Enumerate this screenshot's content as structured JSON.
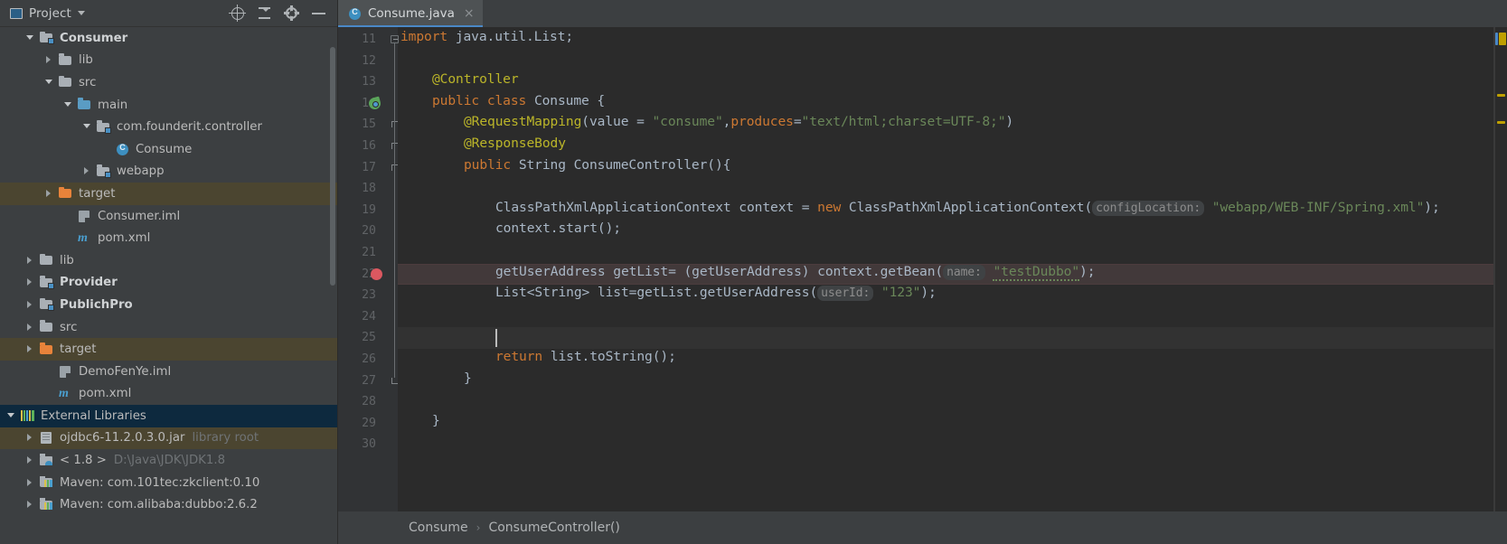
{
  "window": {
    "background": "#3c3f41",
    "editor_background": "#2b2b2b"
  },
  "sidebar": {
    "header": {
      "title": "Project",
      "icons": [
        "project-panel-icon",
        "chevron-down-icon"
      ],
      "actions": [
        {
          "name": "locate-file-icon",
          "tooltip": "Select Opened File"
        },
        {
          "name": "collapse-all-icon",
          "tooltip": "Collapse All"
        },
        {
          "name": "gear-icon",
          "tooltip": "Settings"
        },
        {
          "name": "hide-panel-icon",
          "tooltip": "Hide"
        }
      ]
    },
    "tree": [
      {
        "label": "Consumer",
        "indent": 0,
        "arrow": "open",
        "icon": "module-folder-icon",
        "bold": true,
        "selected": "none"
      },
      {
        "label": "lib",
        "indent": 1,
        "arrow": "closed",
        "icon": "folder-icon",
        "bold": false,
        "selected": "none"
      },
      {
        "label": "src",
        "indent": 1,
        "arrow": "open",
        "icon": "folder-icon",
        "bold": false,
        "selected": "none"
      },
      {
        "label": "main",
        "indent": 2,
        "arrow": "open",
        "icon": "source-folder-icon",
        "bold": false,
        "selected": "none"
      },
      {
        "label": "com.founderit.controller",
        "indent": 3,
        "arrow": "open",
        "icon": "package-icon",
        "bold": false,
        "selected": "none"
      },
      {
        "label": "Consume",
        "indent": 4,
        "arrow": "none",
        "icon": "java-class-icon",
        "bold": false,
        "selected": "none"
      },
      {
        "label": "webapp",
        "indent": 3,
        "arrow": "closed",
        "icon": "web-folder-icon",
        "bold": false,
        "selected": "none"
      },
      {
        "label": "target",
        "indent": 1,
        "arrow": "closed",
        "icon": "excluded-folder-icon",
        "bold": false,
        "selected": "olive"
      },
      {
        "label": "Consumer.iml",
        "indent": 2,
        "arrow": "none",
        "icon": "iml-file-icon",
        "bold": false,
        "selected": "none"
      },
      {
        "label": "pom.xml",
        "indent": 2,
        "arrow": "none",
        "icon": "maven-pom-icon",
        "bold": false,
        "selected": "none"
      },
      {
        "label": "lib",
        "indent": 0,
        "arrow": "closed",
        "icon": "folder-icon",
        "bold": false,
        "selected": "none"
      },
      {
        "label": "Provider",
        "indent": 0,
        "arrow": "closed",
        "icon": "module-folder-icon",
        "bold": true,
        "selected": "none"
      },
      {
        "label": "PublichPro",
        "indent": 0,
        "arrow": "closed",
        "icon": "module-folder-icon",
        "bold": true,
        "selected": "none"
      },
      {
        "label": "src",
        "indent": 0,
        "arrow": "closed",
        "icon": "folder-icon",
        "bold": false,
        "selected": "none"
      },
      {
        "label": "target",
        "indent": 0,
        "arrow": "closed",
        "icon": "excluded-folder-icon",
        "bold": false,
        "selected": "olive"
      },
      {
        "label": "DemoFenYe.iml",
        "indent": 1,
        "arrow": "none",
        "icon": "iml-file-icon",
        "bold": false,
        "selected": "none"
      },
      {
        "label": "pom.xml",
        "indent": 1,
        "arrow": "none",
        "icon": "maven-pom-icon",
        "bold": false,
        "selected": "none"
      },
      {
        "label": "External Libraries",
        "indent": -1,
        "arrow": "open",
        "icon": "external-libraries-icon",
        "bold": false,
        "selected": "blue"
      },
      {
        "label": "ojdbc6-11.2.0.3.0.jar",
        "indent": 0,
        "arrow": "closed",
        "icon": "jar-icon",
        "bold": false,
        "sub": "library root",
        "selected": "olive"
      },
      {
        "label": "< 1.8 >",
        "indent": 0,
        "arrow": "closed",
        "icon": "jdk-icon",
        "bold": false,
        "sub": "D:\\Java\\JDK\\JDK1.8",
        "selected": "none"
      },
      {
        "label": "Maven: com.101tec:zkclient:0.10",
        "indent": 0,
        "arrow": "closed",
        "icon": "maven-library-icon",
        "bold": false,
        "selected": "none"
      },
      {
        "label": "Maven: com.alibaba:dubbo:2.6.2",
        "indent": 0,
        "arrow": "closed",
        "icon": "maven-library-icon",
        "bold": false,
        "selected": "none"
      }
    ]
  },
  "editor": {
    "tab": {
      "label": "Consume.java",
      "icon": "java-class-icon",
      "close": "×",
      "active": true
    },
    "first_line_number": 11,
    "lines": [
      {
        "n": 11,
        "indent": 0,
        "tokens": [
          {
            "t": "import ",
            "c": "kw"
          },
          {
            "t": "java.util.List;",
            "c": "ident"
          }
        ]
      },
      {
        "n": 12,
        "indent": 0,
        "tokens": []
      },
      {
        "n": 13,
        "indent": 1,
        "tokens": [
          {
            "t": "@Controller",
            "c": "ann"
          }
        ]
      },
      {
        "n": 14,
        "indent": 1,
        "tokens": [
          {
            "t": "public ",
            "c": "kw"
          },
          {
            "t": "class ",
            "c": "kw"
          },
          {
            "t": "Consume {",
            "c": "ident"
          }
        ]
      },
      {
        "n": 15,
        "indent": 2,
        "tokens": [
          {
            "t": "@RequestMapping",
            "c": "ann"
          },
          {
            "t": "(value = ",
            "c": "ident"
          },
          {
            "t": "\"consume\"",
            "c": "str"
          },
          {
            "t": ",",
            "c": "ident"
          },
          {
            "t": "produces",
            "c": "kwb"
          },
          {
            "t": "=",
            "c": "ident"
          },
          {
            "t": "\"text/html;charset=UTF-8;\"",
            "c": "str"
          },
          {
            "t": ")",
            "c": "ident"
          }
        ]
      },
      {
        "n": 16,
        "indent": 2,
        "tokens": [
          {
            "t": "@ResponseBody",
            "c": "ann"
          }
        ]
      },
      {
        "n": 17,
        "indent": 2,
        "tokens": [
          {
            "t": "public ",
            "c": "kw"
          },
          {
            "t": "String ",
            "c": "ident"
          },
          {
            "t": "ConsumeController",
            "c": "method"
          },
          {
            "t": "(){",
            "c": "ident"
          }
        ]
      },
      {
        "n": 18,
        "indent": 0,
        "tokens": []
      },
      {
        "n": 19,
        "indent": 3,
        "tokens": [
          {
            "t": "ClassPathXmlApplicationContext context = ",
            "c": "ident"
          },
          {
            "t": "new ",
            "c": "kw"
          },
          {
            "t": "ClassPathXmlApplicationContext(",
            "c": "ident"
          },
          {
            "t": "configLocation:",
            "c": "hint"
          },
          {
            "t": " ",
            "c": "ident"
          },
          {
            "t": "\"webapp/WEB-INF/Spring.xml\"",
            "c": "str"
          },
          {
            "t": ");",
            "c": "ident"
          }
        ]
      },
      {
        "n": 20,
        "indent": 3,
        "tokens": [
          {
            "t": "context.start();",
            "c": "ident"
          }
        ]
      },
      {
        "n": 21,
        "indent": 0,
        "tokens": []
      },
      {
        "n": 22,
        "indent": 3,
        "highlight": "red",
        "breakpoint": true,
        "tokens": [
          {
            "t": "getUserAddress getList= (getUserAddress) context.getBean(",
            "c": "ident"
          },
          {
            "t": "name:",
            "c": "hint"
          },
          {
            "t": " ",
            "c": "ident"
          },
          {
            "t": "\"testDubbo\"",
            "c": "str-typo"
          },
          {
            "t": ");",
            "c": "ident"
          }
        ]
      },
      {
        "n": 23,
        "indent": 3,
        "tokens": [
          {
            "t": "List<String> list=getList.getUserAddress(",
            "c": "ident"
          },
          {
            "t": "userId:",
            "c": "hint"
          },
          {
            "t": " ",
            "c": "ident"
          },
          {
            "t": "\"123\"",
            "c": "str"
          },
          {
            "t": ");",
            "c": "ident"
          }
        ]
      },
      {
        "n": 24,
        "indent": 0,
        "tokens": []
      },
      {
        "n": 25,
        "indent": 0,
        "highlight": "caret",
        "tokens": []
      },
      {
        "n": 26,
        "indent": 3,
        "tokens": [
          {
            "t": "return ",
            "c": "kw"
          },
          {
            "t": "list.toString();",
            "c": "ident"
          }
        ]
      },
      {
        "n": 27,
        "indent": 2,
        "tokens": [
          {
            "t": "}",
            "c": "ident"
          }
        ]
      },
      {
        "n": 28,
        "indent": 0,
        "tokens": []
      },
      {
        "n": 29,
        "indent": 1,
        "tokens": [
          {
            "t": "}",
            "c": "ident"
          }
        ]
      },
      {
        "n": 30,
        "indent": 0,
        "tokens": []
      }
    ],
    "gutter_markers": [
      {
        "line": 14,
        "name": "spring-bean-gutter-icon"
      },
      {
        "line": 22,
        "name": "breakpoint-icon"
      }
    ],
    "breadcrumbs": [
      "Consume",
      "ConsumeController()"
    ],
    "breadcrumb_separator": "›"
  },
  "colors": {
    "keyword": "#cc7832",
    "string": "#6a8759",
    "annotation": "#bbb529",
    "identifier": "#a9b7c6",
    "hint_text": "#8c8c8c",
    "breakpoint": "#db5860",
    "selection_blue": "#0d293e",
    "selection_olive": "#4b4530",
    "tab_underline": "#4a88c7",
    "warning_marker": "#bfa000"
  }
}
